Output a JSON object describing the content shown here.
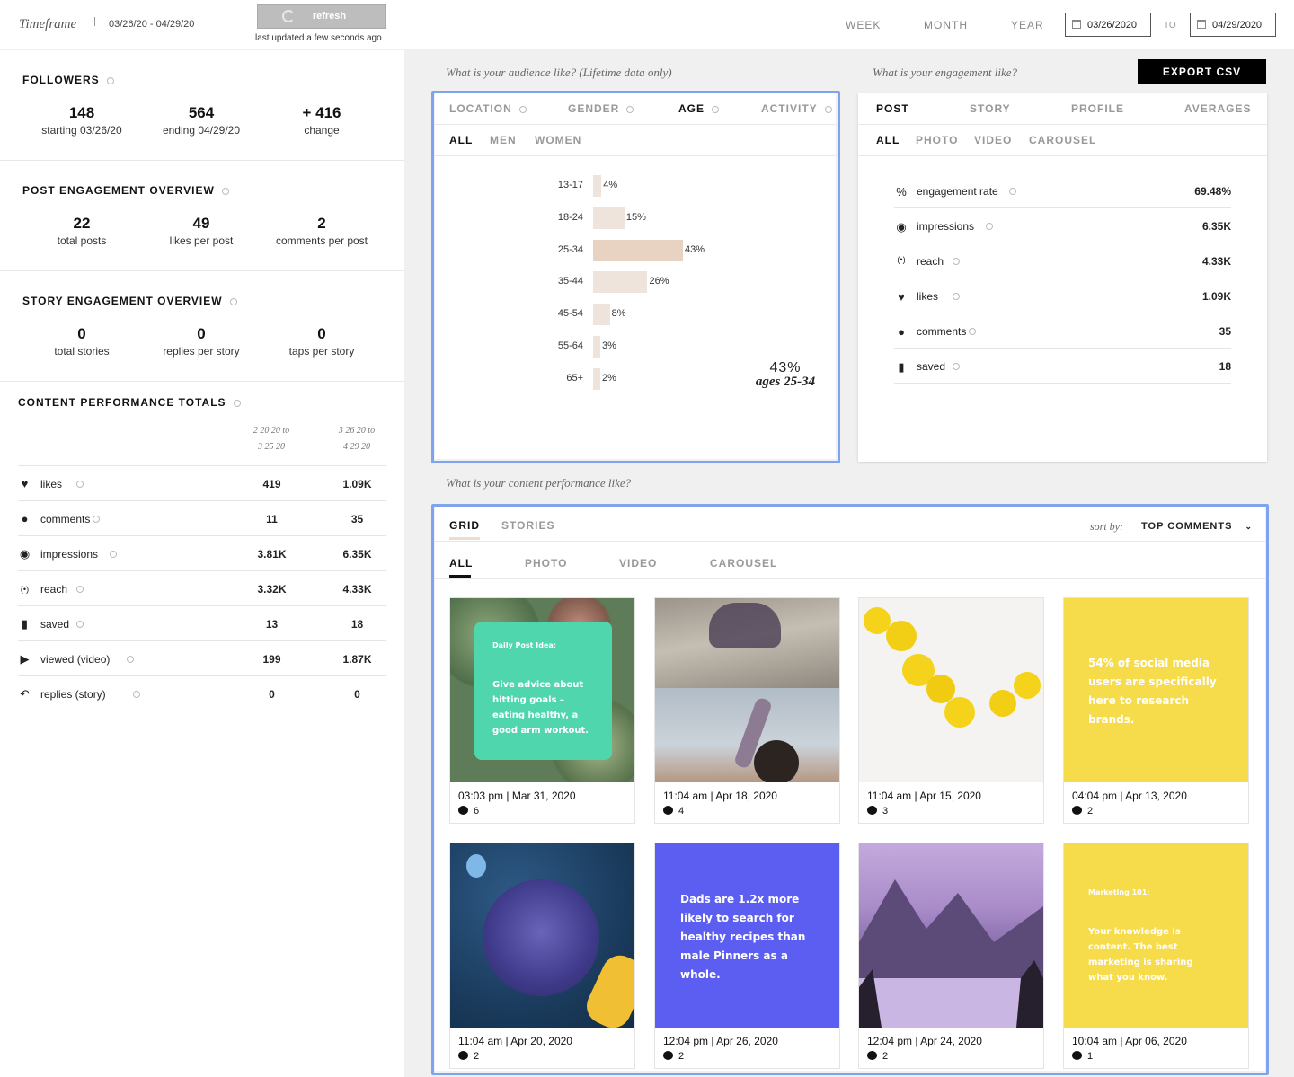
{
  "topbar": {
    "timeframe_label": "Timeframe",
    "range": "03/26/20 - 04/29/20",
    "refresh_label": "refresh",
    "updated": "last updated a few seconds ago",
    "week": "WEEK",
    "month": "MONTH",
    "year": "YEAR",
    "date_from": "03/26/2020",
    "to": "TO",
    "date_to": "04/29/2020"
  },
  "followers": {
    "title": "FOLLOWERS",
    "stats": [
      {
        "value": "148",
        "label": "starting 03/26/20"
      },
      {
        "value": "564",
        "label": "ending 04/29/20"
      },
      {
        "value": "+ 416",
        "label": "change"
      }
    ]
  },
  "post_engagement": {
    "title": "POST ENGAGEMENT OVERVIEW",
    "stats": [
      {
        "value": "22",
        "label": "total posts"
      },
      {
        "value": "49",
        "label": "likes per post"
      },
      {
        "value": "2",
        "label": "comments per post"
      }
    ]
  },
  "story_engagement": {
    "title": "STORY ENGAGEMENT OVERVIEW",
    "stats": [
      {
        "value": "0",
        "label": "total stories"
      },
      {
        "value": "0",
        "label": "replies per story"
      },
      {
        "value": "0",
        "label": "taps per story"
      }
    ]
  },
  "content_totals": {
    "title": "CONTENT PERFORMANCE TOTALS",
    "col_a": [
      "2 20 20 to",
      "3 25 20"
    ],
    "col_b": [
      "3 26 20 to",
      "4 29 20"
    ],
    "rows": [
      {
        "icon": "heart-icon",
        "name": "likes",
        "a": "419",
        "b": "1.09K"
      },
      {
        "icon": "comment-icon",
        "name": "comments",
        "a": "11",
        "b": "35"
      },
      {
        "icon": "eye-icon",
        "name": "impressions",
        "a": "3.81K",
        "b": "6.35K"
      },
      {
        "icon": "broadcast-icon",
        "name": "reach",
        "a": "3.32K",
        "b": "4.33K"
      },
      {
        "icon": "bookmark-icon",
        "name": "saved",
        "a": "13",
        "b": "18"
      },
      {
        "icon": "play-icon",
        "name": "viewed (video)",
        "a": "199",
        "b": "1.87K"
      },
      {
        "icon": "reply-icon",
        "name": "replies (story)",
        "a": "0",
        "b": "0"
      }
    ]
  },
  "audience": {
    "caption": "What is your audience like? (Lifetime data only)",
    "tabs": [
      "LOCATION",
      "GENDER",
      "AGE",
      "ACTIVITY"
    ],
    "active_tab": "AGE",
    "subtabs": [
      "ALL",
      "MEN",
      "WOMEN"
    ],
    "highlight_value": "43%",
    "highlight_label": "ages 25-34",
    "accent_color": "#e8d2c2"
  },
  "chart_data": {
    "type": "bar",
    "orientation": "horizontal",
    "categories": [
      "13-17",
      "18-24",
      "25-34",
      "35-44",
      "45-54",
      "55-64",
      "65+"
    ],
    "values": [
      4,
      15,
      43,
      26,
      8,
      3,
      2
    ],
    "value_labels": [
      "4%",
      "15%",
      "43%",
      "26%",
      "8%",
      "3%",
      "2%"
    ],
    "highlight_index": 2
  },
  "engagement": {
    "caption": "What is your engagement like?",
    "export_label": "EXPORT CSV",
    "tabs": [
      "POST",
      "STORY",
      "PROFILE",
      "AVERAGES"
    ],
    "subtabs": [
      "ALL",
      "PHOTO",
      "VIDEO",
      "CAROUSEL"
    ],
    "rows": [
      {
        "icon": "percent-icon",
        "name": "engagement rate",
        "value": "69.48%"
      },
      {
        "icon": "eye-icon",
        "name": "impressions",
        "value": "6.35K"
      },
      {
        "icon": "broadcast-icon",
        "name": "reach",
        "value": "4.33K"
      },
      {
        "icon": "heart-icon",
        "name": "likes",
        "value": "1.09K"
      },
      {
        "icon": "comment-icon",
        "name": "comments",
        "value": "35"
      },
      {
        "icon": "bookmark-icon",
        "name": "saved",
        "value": "18"
      }
    ]
  },
  "content": {
    "caption": "What is your content performance like?",
    "tabs": [
      "GRID",
      "STORIES"
    ],
    "sort_label": "sort by:",
    "sort_value": "TOP COMMENTS",
    "subtabs": [
      "ALL",
      "PHOTO",
      "VIDEO",
      "CAROUSEL"
    ],
    "posts": [
      {
        "time": "03:03 pm | Mar 31, 2020",
        "comments": "6",
        "title": "Daily Post Idea:",
        "text": "Give advice about hitting goals – eating healthy, a good arm workout."
      },
      {
        "time": "11:04 am | Apr 18, 2020",
        "comments": "4"
      },
      {
        "time": "11:04 am | Apr 15, 2020",
        "comments": "3"
      },
      {
        "time": "04:04 pm | Apr 13, 2020",
        "comments": "2",
        "text": "54% of social media users are specifically here to research brands."
      },
      {
        "time": "11:04 am | Apr 20, 2020",
        "comments": "2"
      },
      {
        "time": "12:04 pm | Apr 26, 2020",
        "comments": "2",
        "text": "Dads are 1.2x more likely to search for healthy recipes than male Pinners as a whole."
      },
      {
        "time": "12:04 pm | Apr 24, 2020",
        "comments": "2"
      },
      {
        "time": "10:04 am | Apr 06, 2020",
        "comments": "1",
        "title": "Marketing 101:",
        "text": "Your knowledge is content. The best marketing is sharing what you know."
      }
    ]
  }
}
